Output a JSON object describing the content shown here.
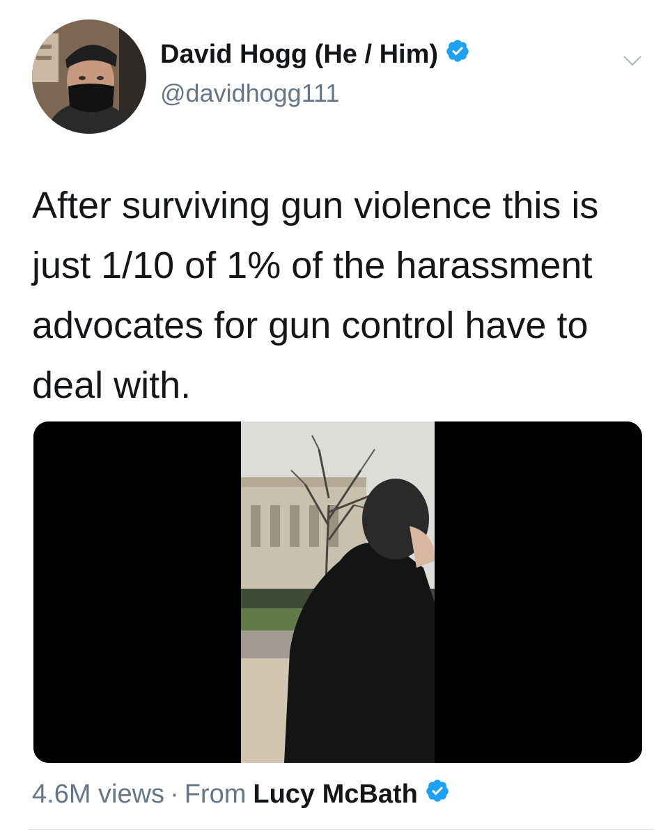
{
  "author": {
    "display_name": "David Hogg (He / Him)",
    "handle": "@davidhogg111",
    "verified_icon": "verified-badge-icon",
    "avatar_icon": "profile-avatar"
  },
  "tweet": {
    "text": "After surviving gun violence this is just 1/10 of 1% of the harassment advocates for gun control have to deal with."
  },
  "media": {
    "type": "video",
    "thumbnail": "video-thumbnail"
  },
  "video_meta": {
    "views": "4.6M views",
    "separator": "·",
    "from_label": "From",
    "source_name": "Lucy McBath"
  },
  "colors": {
    "verified_blue": "#1da1f2",
    "secondary_text": "#657786",
    "primary_text": "#14171a"
  }
}
